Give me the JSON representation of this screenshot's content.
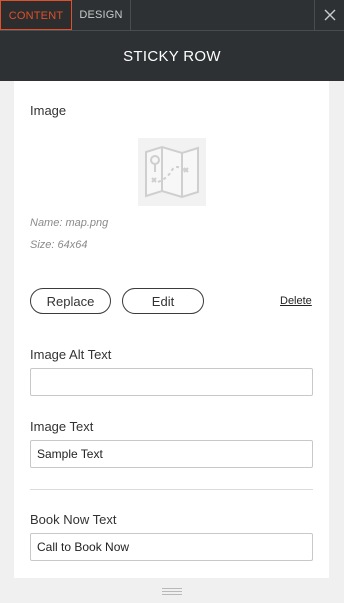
{
  "tabs": {
    "content": "CONTENT",
    "design": "DESIGN"
  },
  "header": {
    "title": "STICKY ROW"
  },
  "image_section": {
    "label": "Image",
    "thumbnail_icon": "map-icon",
    "name": "Name: map.png",
    "size": "Size: 64x64",
    "replace_label": "Replace",
    "edit_label": "Edit",
    "delete_label": "Delete"
  },
  "image_alt": {
    "label": "Image Alt Text",
    "value": ""
  },
  "image_text": {
    "label": "Image Text",
    "value": "Sample Text"
  },
  "book_now": {
    "label": "Book Now Text",
    "value": "Call to Book Now"
  },
  "colors": {
    "accent": "#e0502a",
    "topbar": "#2e3133",
    "panel": "#ffffff",
    "page": "#f0f0f0"
  }
}
